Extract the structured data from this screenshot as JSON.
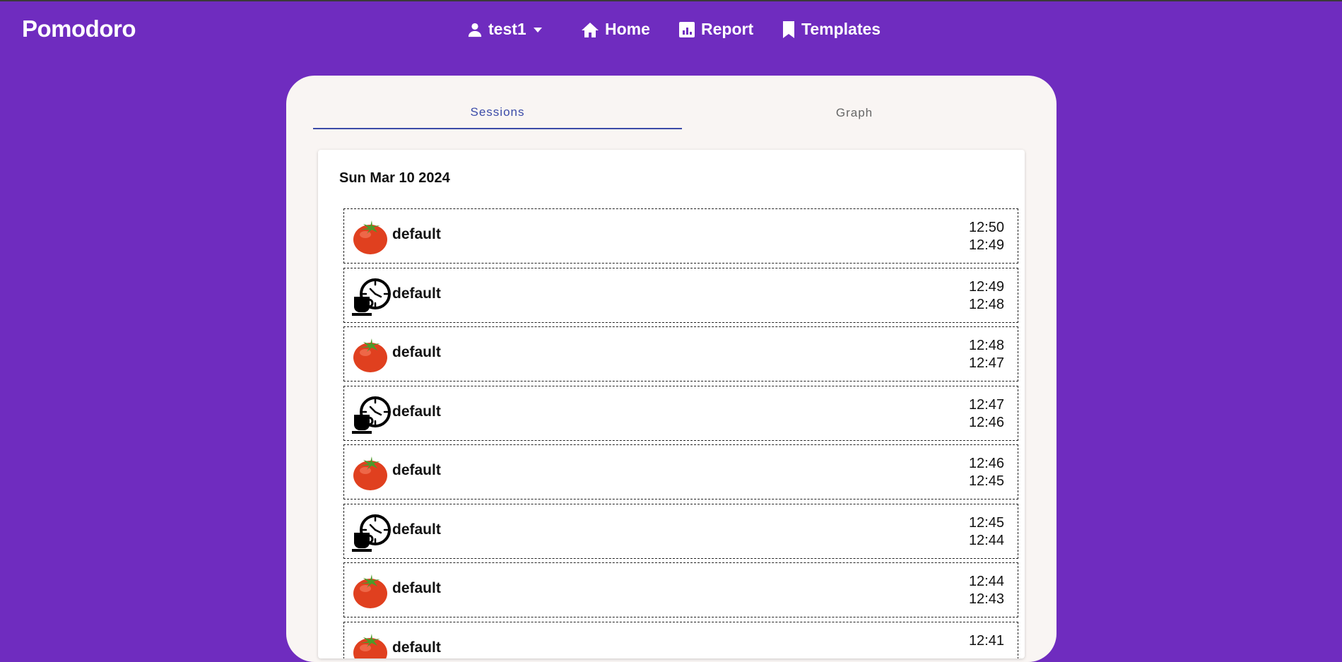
{
  "brand": "Pomodoro",
  "nav": {
    "user_label": "test1",
    "home_label": "Home",
    "report_label": "Report",
    "templates_label": "Templates"
  },
  "tabs": {
    "sessions_label": "Sessions",
    "graph_label": "Graph"
  },
  "day": {
    "date": "Sun Mar 10 2024"
  },
  "sessions": [
    {
      "type": "pomodoro",
      "icon": "tomato-icon",
      "name": "default",
      "end": "12:50",
      "start": "12:49"
    },
    {
      "type": "break",
      "icon": "coffee-clock-icon",
      "name": "default",
      "end": "12:49",
      "start": "12:48"
    },
    {
      "type": "pomodoro",
      "icon": "tomato-icon",
      "name": "default",
      "end": "12:48",
      "start": "12:47"
    },
    {
      "type": "break",
      "icon": "coffee-clock-icon",
      "name": "default",
      "end": "12:47",
      "start": "12:46"
    },
    {
      "type": "pomodoro",
      "icon": "tomato-icon",
      "name": "default",
      "end": "12:46",
      "start": "12:45"
    },
    {
      "type": "break",
      "icon": "coffee-clock-icon",
      "name": "default",
      "end": "12:45",
      "start": "12:44"
    },
    {
      "type": "pomodoro",
      "icon": "tomato-icon",
      "name": "default",
      "end": "12:44",
      "start": "12:43"
    },
    {
      "type": "pomodoro",
      "icon": "tomato-icon",
      "name": "default",
      "end": "12:41",
      "start": ""
    }
  ],
  "colors": {
    "background": "#6f2cbf",
    "panel": "#f9f5f3",
    "accent": "#3b4ba8",
    "tomato": "#e0401f"
  }
}
